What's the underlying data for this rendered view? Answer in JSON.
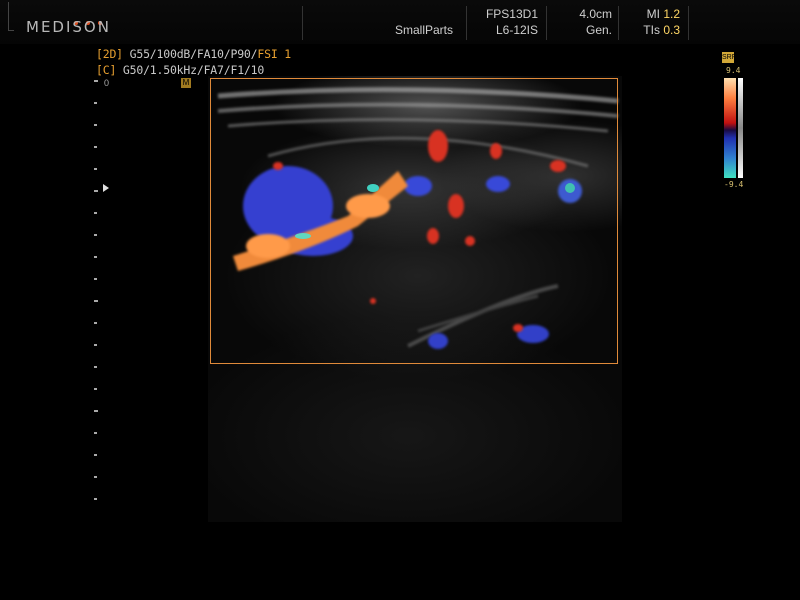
{
  "header": {
    "logo": "MEDISON",
    "logo_dot_colors": [
      "#e05020",
      "#e05020",
      "#e05020"
    ],
    "preset": "SmallParts",
    "probe_line1": "FPS13D1",
    "probe_line2": "L6-12IS",
    "depth": "4.0cm",
    "depth_mode": "Gen.",
    "mi_label": "MI",
    "mi_value": "1.2",
    "tis_label": "TIs",
    "tis_value": "0.3"
  },
  "params": {
    "row1_tag": "[2D]",
    "row1_text": " G55/100dB/FA10/P90/",
    "row1_fsi": "FSI 1",
    "row2_tag": "[C]",
    "row2_text": " G50/1.50kHz/FA7/F1/10"
  },
  "scale": {
    "zero_label": "0"
  },
  "icons": {
    "m_marker": "M",
    "colorbar_badge": "SRF"
  },
  "colorbar": {
    "top_value": "9.4",
    "bottom_value": "-9.4"
  },
  "colors": {
    "color_box": "#e08a3a",
    "accent": "#e8a030",
    "value_yellow": "#ffd766"
  }
}
